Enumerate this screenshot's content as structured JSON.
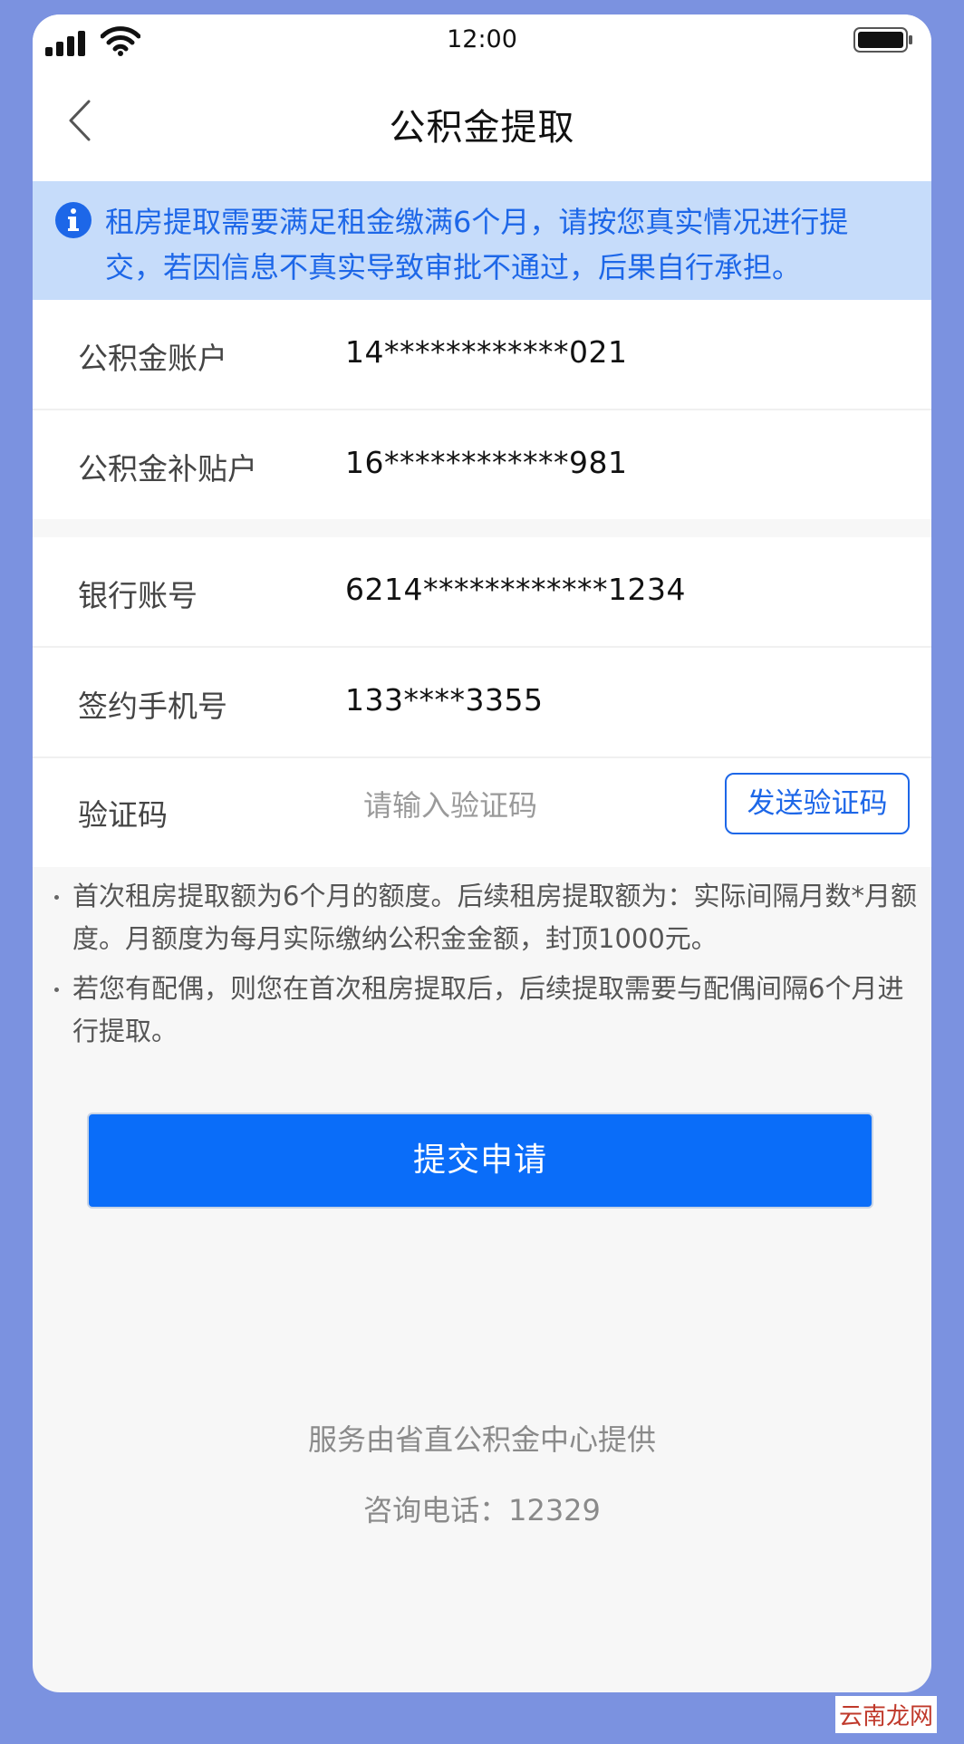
{
  "status_bar": {
    "time": "12:00"
  },
  "nav": {
    "title": "公积金提取"
  },
  "notice": {
    "text": "租房提取需要满足租金缴满6个月，请按您真实情况进行提交，若因信息不真实导致审批不通过，后果自行承担。"
  },
  "accounts": [
    {
      "label": "公积金账户",
      "value": "14************021"
    },
    {
      "label": "公积金补贴户",
      "value": "16************981"
    }
  ],
  "bank": [
    {
      "label": "银行账号",
      "value": "6214************1234"
    },
    {
      "label": "签约手机号",
      "value": "133****3355"
    }
  ],
  "verify": {
    "label": "验证码",
    "placeholder": "请输入验证码",
    "send_label": "发送验证码"
  },
  "notes": [
    "首次租房提取额为6个月的额度。后续租房提取额为：实际间隔月数*月额度。月额度为每月实际缴纳公积金金额，封顶1000元。",
    "若您有配偶，则您在首次租房提取后，后续提取需要与配偶间隔6个月进行提取。"
  ],
  "submit_label": "提交申请",
  "footer": {
    "provider": "服务由省直公积金中心提供",
    "hotline": "咨询电话：12329"
  },
  "watermark": "云南龙网"
}
